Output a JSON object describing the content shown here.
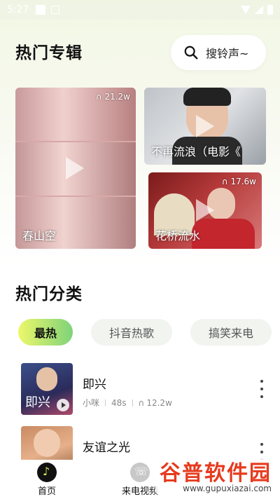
{
  "status_bar": {
    "time": "5:27"
  },
  "header": {
    "title": "热门专辑",
    "search_placeholder": "搜铃声~"
  },
  "albums": [
    {
      "title": "春山空",
      "plays": "21.2w"
    },
    {
      "title": "不再流浪（电影《",
      "plays": ""
    },
    {
      "title": "花桥流水",
      "plays": "17.6w"
    }
  ],
  "categories": {
    "title": "热门分类",
    "chips": [
      "最热",
      "抖音热歌",
      "搞笑来电"
    ]
  },
  "songs": [
    {
      "title": "即兴",
      "artist": "小咪",
      "duration": "48s",
      "plays": "12.2w",
      "thumb_text": "即兴"
    },
    {
      "title": "友谊之光",
      "artist": "",
      "duration": "",
      "plays": ""
    }
  ],
  "tabbar": {
    "home": "首页",
    "call_video": "来电视频"
  },
  "watermark": {
    "logo": "谷普软件园",
    "url": "www.gupuxiazai.com"
  },
  "colors": {
    "accent_gradient_start": "#eef76a",
    "accent_gradient_end": "#7ed37a",
    "watermark": "#e63a1e"
  }
}
